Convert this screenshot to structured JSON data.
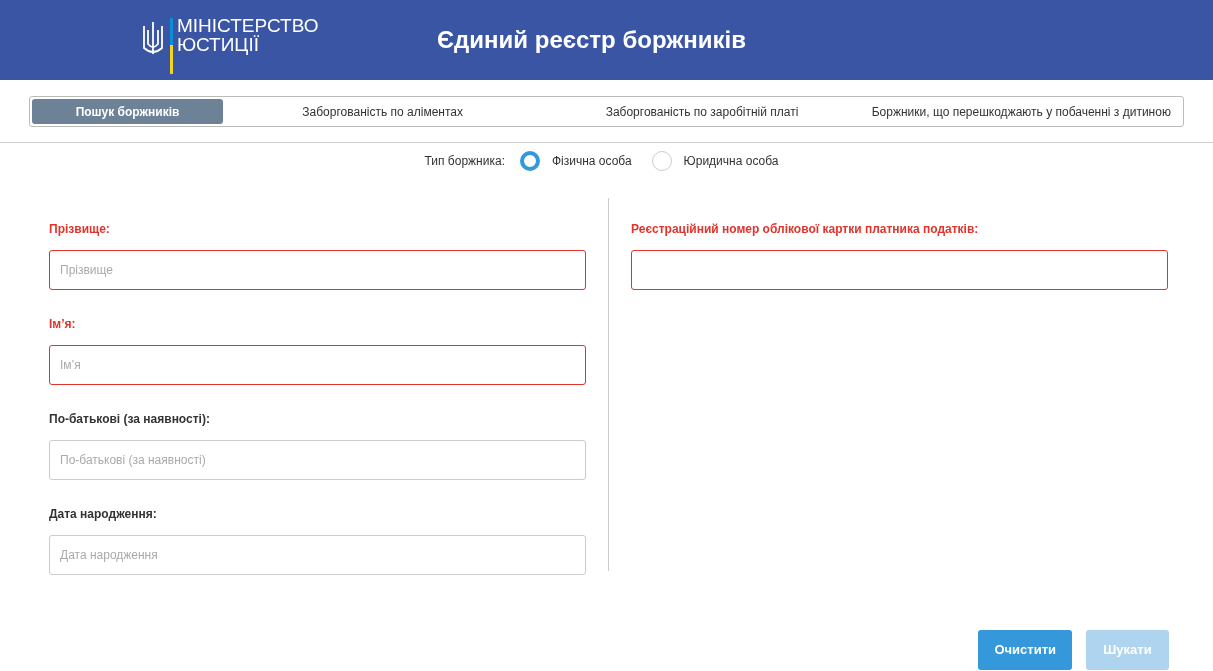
{
  "header": {
    "logo_line_1": "МІНІСТЕРСТВО",
    "logo_line_2": "ЮСТИЦІЇ",
    "title": "Єдиний реєстр боржників"
  },
  "tabs": [
    {
      "label": "Пошук боржників",
      "selected": true
    },
    {
      "label": "Заборгованість по аліментах",
      "selected": false
    },
    {
      "label": "Заборгованість по заробітній платі",
      "selected": false
    },
    {
      "label": "Боржники, що перешкоджають у побаченні з дитиною",
      "selected": false
    }
  ],
  "debtor_type": {
    "label": "Тип боржника:",
    "options": [
      {
        "label": "Фізична особа",
        "selected": true
      },
      {
        "label": "Юридична особа",
        "selected": false
      }
    ]
  },
  "left_fields": [
    {
      "label": "Прізвище:",
      "placeholder": "Прізвище",
      "required": true
    },
    {
      "label": "Ім’я:",
      "placeholder": "Ім’я",
      "required": true
    },
    {
      "label": "По-батькові (за наявності):",
      "placeholder": "По-батькові (за наявності)",
      "required": false
    },
    {
      "label": "Дата народження:",
      "placeholder": "Дата народження",
      "required": false
    }
  ],
  "right_fields": [
    {
      "label": "Реєстраційний номер облікової картки платника податків:",
      "required": true
    }
  ],
  "buttons": [
    {
      "label": "Очистити",
      "disabled": false
    },
    {
      "label": "Шукати",
      "disabled": true
    }
  ]
}
